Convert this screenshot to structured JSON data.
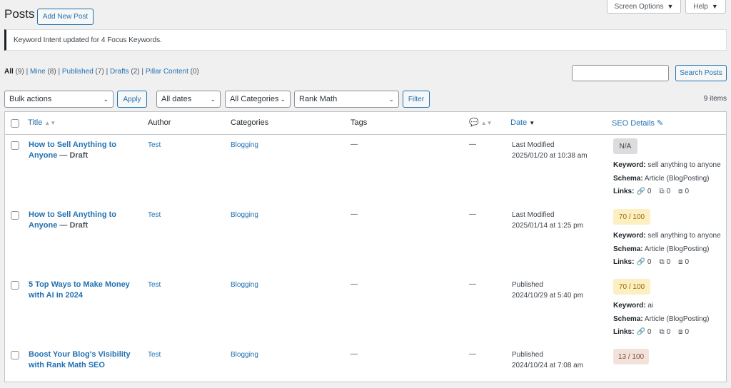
{
  "header": {
    "title": "Posts",
    "add_new": "Add New Post",
    "screen_options": "Screen Options",
    "help": "Help"
  },
  "notice": "Keyword Intent updated for 4 Focus Keywords.",
  "filters": {
    "all": "All",
    "all_count": "(9)",
    "mine": "Mine",
    "mine_count": "(8)",
    "published": "Published",
    "published_count": "(7)",
    "drafts": "Drafts",
    "drafts_count": "(2)",
    "pillar": "Pillar Content",
    "pillar_count": "(0)",
    "separator": "|"
  },
  "search": {
    "button": "Search Posts",
    "value": ""
  },
  "toolbar": {
    "bulk_actions": "Bulk actions",
    "apply": "Apply",
    "dates": "All dates",
    "categories": "All Categories",
    "rank_math": "Rank Math",
    "filter": "Filter",
    "items_count": "9 items"
  },
  "columns": {
    "title": "Title",
    "author": "Author",
    "categories": "Categories",
    "tags": "Tags",
    "date": "Date",
    "seo": "SEO Details"
  },
  "seo_labels": {
    "keyword": "Keyword:",
    "schema": "Schema:",
    "links": "Links:"
  },
  "rows": [
    {
      "title_line1": "How to Sell Anything to",
      "title_line2": "Anyone",
      "state": "— Draft",
      "author": "Test",
      "category": "Blogging",
      "tags": "—",
      "comments": "—",
      "date_status": "Last Modified",
      "date_value": "2025/01/20 at 10:38 am",
      "score": "N/A",
      "keyword": "sell anything to anyone",
      "schema": "Article (BlogPosting)",
      "links_internal": "0",
      "links_external": "0",
      "links_incoming": "0"
    },
    {
      "title_line1": "How to Sell Anything to",
      "title_line2": "Anyone",
      "state": "— Draft",
      "author": "Test",
      "category": "Blogging",
      "tags": "—",
      "comments": "—",
      "date_status": "Last Modified",
      "date_value": "2025/01/14 at 1:25 pm",
      "score": "70 / 100",
      "keyword": "sell anything to anyone",
      "schema": "Article (BlogPosting)",
      "links_internal": "0",
      "links_external": "0",
      "links_incoming": "0"
    },
    {
      "title_line1": "5 Top Ways to Make Money",
      "title_line2": "with AI in 2024",
      "state": "",
      "author": "Test",
      "category": "Blogging",
      "tags": "—",
      "comments": "—",
      "date_status": "Published",
      "date_value": "2024/10/29 at 5:40 pm",
      "score": "70 / 100",
      "keyword": "ai",
      "schema": "Article (BlogPosting)",
      "links_internal": "0",
      "links_external": "0",
      "links_incoming": "0"
    },
    {
      "title_line1": "Boost Your Blog's Visibility",
      "title_line2": "with Rank Math SEO",
      "state": "",
      "author": "Test",
      "category": "Blogging",
      "tags": "—",
      "comments": "—",
      "date_status": "Published",
      "date_value": "2024/10/24 at 7:08 am",
      "score": "13 / 100"
    }
  ]
}
